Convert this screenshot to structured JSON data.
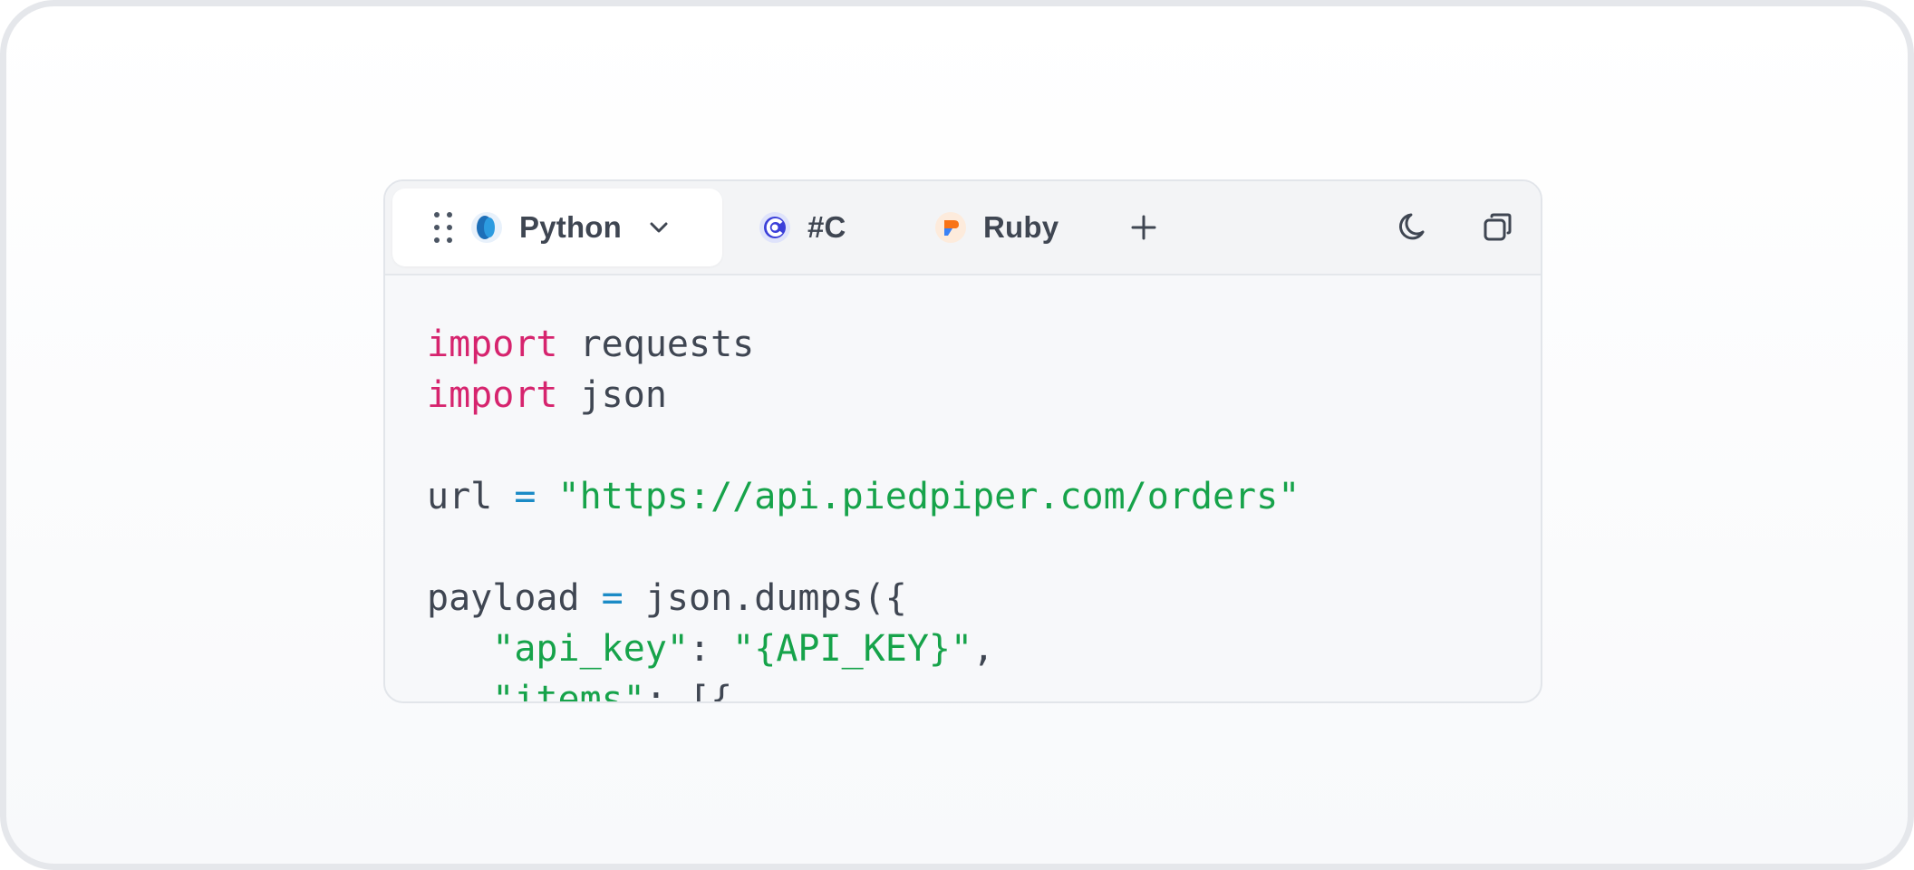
{
  "tabs": [
    {
      "label": "Python",
      "icon": "python-icon",
      "active": true
    },
    {
      "label": "#C",
      "icon": "csharp-icon",
      "active": false
    },
    {
      "label": "Ruby",
      "icon": "ruby-icon",
      "active": false
    }
  ],
  "toolbar": {
    "add_label": "+",
    "theme_icon": "moon-icon",
    "copy_icon": "copy-icon"
  },
  "code": {
    "language": "Python",
    "lines": [
      [
        {
          "t": "kw",
          "v": "import"
        },
        {
          "t": "plain",
          "v": " requests"
        }
      ],
      [
        {
          "t": "kw",
          "v": "import"
        },
        {
          "t": "plain",
          "v": " json"
        }
      ],
      [],
      [
        {
          "t": "plain",
          "v": "url "
        },
        {
          "t": "op",
          "v": "="
        },
        {
          "t": "plain",
          "v": " "
        },
        {
          "t": "str",
          "v": "\"https://api.piedpiper.com/orders\""
        }
      ],
      [],
      [
        {
          "t": "plain",
          "v": "payload "
        },
        {
          "t": "op",
          "v": "="
        },
        {
          "t": "plain",
          "v": " json.dumps({"
        }
      ],
      [
        {
          "t": "plain",
          "v": "   "
        },
        {
          "t": "str",
          "v": "\"api_key\""
        },
        {
          "t": "plain",
          "v": ": "
        },
        {
          "t": "str",
          "v": "\"{API_KEY}\""
        },
        {
          "t": "plain",
          "v": ","
        }
      ],
      [
        {
          "t": "plain",
          "v": "   "
        },
        {
          "t": "str",
          "v": "\"items\""
        },
        {
          "t": "plain",
          "v": ": [{"
        }
      ]
    ]
  },
  "colors": {
    "keyword": "#d6246e",
    "operator": "#1b8bc6",
    "string": "#16a34a",
    "text": "#3f4652"
  }
}
